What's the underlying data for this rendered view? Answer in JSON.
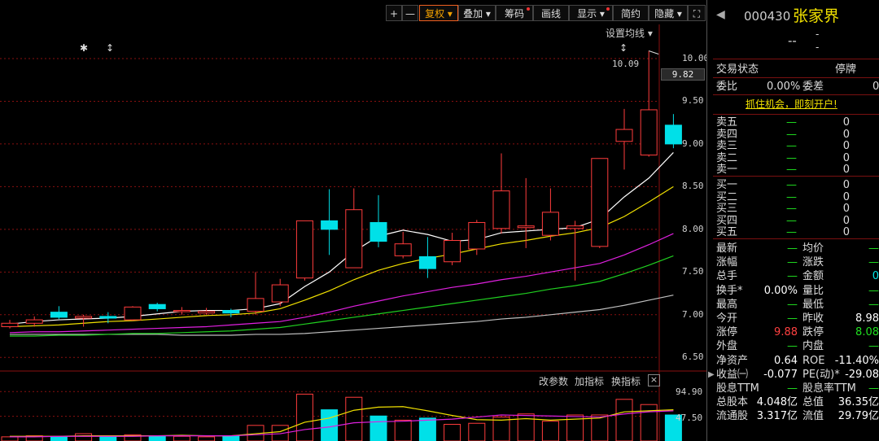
{
  "toolbar": {
    "plus": "+",
    "minus": "—",
    "restore_rights": "复权",
    "overlay": "叠加",
    "chips": "筹码",
    "draw_line": "画线",
    "display": "显示",
    "simple": "简约",
    "hide": "隐藏",
    "ma_settings": "设置均线"
  },
  "chart": {
    "high_label": "10.09",
    "current_price_tag": "9.82",
    "yaxis_ticks": [
      "10.00",
      "9.50",
      "9.00",
      "8.50",
      "8.00",
      "7.50",
      "7.00",
      "6.50"
    ],
    "indicator_buttons": {
      "change_params": "改参数",
      "add_indicator": "加指标",
      "switch_indicator": "换指标",
      "close": "×"
    },
    "volume_ticks": [
      "94.90",
      "47.50"
    ],
    "colors": {
      "up": "#ff3c3c",
      "down": "#00e0e8",
      "ma5": "#ffffff",
      "ma10": "#f0e000",
      "ma20": "#e020e0",
      "ma30": "#20d020",
      "ma60": "#c0c0c0",
      "grid": "#8a1010"
    }
  },
  "chart_data": {
    "type": "candlestick",
    "ylim": [
      6.35,
      10.4
    ],
    "candles": [
      {
        "o": 6.86,
        "c": 6.9,
        "h": 6.94,
        "l": 6.84
      },
      {
        "o": 6.9,
        "c": 6.94,
        "h": 6.98,
        "l": 6.86
      },
      {
        "o": 7.03,
        "c": 6.97,
        "h": 7.1,
        "l": 6.95
      },
      {
        "o": 6.96,
        "c": 6.98,
        "h": 7.0,
        "l": 6.86
      },
      {
        "o": 6.98,
        "c": 6.96,
        "h": 7.03,
        "l": 6.9
      },
      {
        "o": 6.94,
        "c": 7.09,
        "h": 7.1,
        "l": 6.93
      },
      {
        "o": 7.12,
        "c": 7.07,
        "h": 7.14,
        "l": 7.04
      },
      {
        "o": 7.05,
        "c": 7.05,
        "h": 7.09,
        "l": 7.0
      },
      {
        "o": 7.02,
        "c": 7.04,
        "h": 7.08,
        "l": 7.0
      },
      {
        "o": 7.05,
        "c": 7.02,
        "h": 7.07,
        "l": 6.97
      },
      {
        "o": 7.04,
        "c": 7.19,
        "h": 7.5,
        "l": 7.0
      },
      {
        "o": 7.15,
        "c": 7.35,
        "h": 7.42,
        "l": 7.1
      },
      {
        "o": 7.43,
        "c": 8.1,
        "h": 8.1,
        "l": 7.4
      },
      {
        "o": 8.1,
        "c": 8.0,
        "h": 8.47,
        "l": 7.7
      },
      {
        "o": 7.55,
        "c": 8.23,
        "h": 8.48,
        "l": 7.55
      },
      {
        "o": 8.08,
        "c": 7.86,
        "h": 8.4,
        "l": 7.79
      },
      {
        "o": 7.69,
        "c": 7.83,
        "h": 7.97,
        "l": 7.66
      },
      {
        "o": 7.68,
        "c": 7.54,
        "h": 7.91,
        "l": 7.43
      },
      {
        "o": 7.62,
        "c": 7.87,
        "h": 7.96,
        "l": 7.58
      },
      {
        "o": 7.77,
        "c": 8.08,
        "h": 8.11,
        "l": 7.7
      },
      {
        "o": 8.01,
        "c": 8.45,
        "h": 8.89,
        "l": 7.95
      },
      {
        "o": 8.02,
        "c": 8.04,
        "h": 8.6,
        "l": 7.78
      },
      {
        "o": 7.93,
        "c": 8.2,
        "h": 8.48,
        "l": 7.87
      },
      {
        "o": 8.01,
        "c": 8.04,
        "h": 8.1,
        "l": 7.4
      },
      {
        "o": 7.8,
        "c": 8.83,
        "h": 8.83,
        "l": 7.78
      },
      {
        "o": 9.03,
        "c": 9.17,
        "h": 9.41,
        "l": 8.7
      },
      {
        "o": 8.87,
        "c": 9.4,
        "h": 10.09,
        "l": 8.85
      },
      {
        "o": 9.22,
        "c": 9.0,
        "h": 9.35,
        "l": 8.95
      }
    ],
    "ma5": [
      6.89,
      6.92,
      6.94,
      6.95,
      6.96,
      6.98,
      7.01,
      7.04,
      7.05,
      7.05,
      7.07,
      7.13,
      7.33,
      7.5,
      7.74,
      7.92,
      7.99,
      7.94,
      7.86,
      7.88,
      7.96,
      7.98,
      8.0,
      8.02,
      8.12,
      8.38,
      8.6,
      8.9
    ],
    "ma10": [
      6.86,
      6.87,
      6.88,
      6.9,
      6.92,
      6.93,
      6.95,
      6.97,
      6.99,
      7.0,
      7.02,
      7.07,
      7.17,
      7.28,
      7.41,
      7.52,
      7.6,
      7.66,
      7.71,
      7.77,
      7.83,
      7.87,
      7.92,
      7.96,
      8.02,
      8.15,
      8.32,
      8.5
    ],
    "ma20": [
      6.79,
      6.8,
      6.8,
      6.81,
      6.82,
      6.83,
      6.84,
      6.85,
      6.86,
      6.88,
      6.9,
      6.92,
      6.97,
      7.03,
      7.1,
      7.16,
      7.22,
      7.27,
      7.32,
      7.36,
      7.41,
      7.45,
      7.5,
      7.55,
      7.6,
      7.7,
      7.82,
      7.95
    ],
    "ma30": [
      6.75,
      6.75,
      6.76,
      6.76,
      6.77,
      6.78,
      6.78,
      6.79,
      6.8,
      6.81,
      6.83,
      6.85,
      6.89,
      6.93,
      6.97,
      7.01,
      7.05,
      7.09,
      7.13,
      7.17,
      7.21,
      7.25,
      7.3,
      7.34,
      7.39,
      7.48,
      7.58,
      7.69
    ],
    "ma60": [
      6.77,
      6.77,
      6.77,
      6.77,
      6.77,
      6.77,
      6.77,
      6.76,
      6.76,
      6.76,
      6.77,
      6.77,
      6.78,
      6.8,
      6.82,
      6.84,
      6.86,
      6.88,
      6.9,
      6.92,
      6.95,
      6.97,
      7.0,
      7.03,
      7.06,
      7.11,
      7.17,
      7.23
    ],
    "volume_ylim": [
      0,
      100
    ],
    "volume": [
      8,
      10,
      8,
      14,
      9,
      12,
      10,
      9,
      8,
      10,
      30,
      30,
      90,
      60,
      84,
      48,
      40,
      44,
      32,
      34,
      46,
      52,
      38,
      50,
      50,
      80,
      70,
      50
    ],
    "vol_ma5": [
      9,
      9,
      9,
      10,
      10,
      10,
      10,
      11,
      10,
      10,
      14,
      18,
      36,
      44,
      59,
      65,
      66,
      58,
      49,
      41,
      40,
      43,
      40,
      42,
      44,
      56,
      58,
      60
    ],
    "vol_ma10": [
      8,
      8,
      9,
      9,
      9,
      9,
      10,
      10,
      10,
      10,
      12,
      14,
      22,
      27,
      35,
      37,
      38,
      40,
      42,
      46,
      50,
      49,
      48,
      47,
      46,
      52,
      56,
      58
    ]
  },
  "quote": {
    "code": "000430",
    "name": "张家界",
    "price": "--",
    "change_top": "-",
    "change_bottom": "-",
    "status_label": "交易状态",
    "status_value": "停牌",
    "weibi_label": "委比",
    "weibi_value": "0.00%",
    "weicha_label": "委差",
    "weicha_value": "0",
    "promo": "抓住机会，即刻开户!",
    "sell_levels": [
      {
        "label": "卖五",
        "price": "—",
        "vol": "0"
      },
      {
        "label": "卖四",
        "price": "—",
        "vol": "0"
      },
      {
        "label": "卖三",
        "price": "—",
        "vol": "0"
      },
      {
        "label": "卖二",
        "price": "—",
        "vol": "0"
      },
      {
        "label": "卖一",
        "price": "—",
        "vol": "0"
      }
    ],
    "buy_levels": [
      {
        "label": "买一",
        "price": "—",
        "vol": "0"
      },
      {
        "label": "买二",
        "price": "—",
        "vol": "0"
      },
      {
        "label": "买三",
        "price": "—",
        "vol": "0"
      },
      {
        "label": "买四",
        "price": "—",
        "vol": "0"
      },
      {
        "label": "买五",
        "price": "—",
        "vol": "0"
      }
    ],
    "stats": [
      {
        "l1": "最新",
        "v1": "—",
        "l2": "均价",
        "v2": "—"
      },
      {
        "l1": "涨幅",
        "v1": "—",
        "l2": "涨跌",
        "v2": "—"
      },
      {
        "l1": "总手",
        "v1": "—",
        "l2": "金额",
        "v2": "0"
      },
      {
        "l1": "换手*",
        "v1": "0.00%",
        "l2": "量比",
        "v2": "—"
      },
      {
        "l1": "最高",
        "v1": "—",
        "l2": "最低",
        "v2": "—"
      },
      {
        "l1": "今开",
        "v1": "—",
        "l2": "昨收",
        "v2": "8.98"
      },
      {
        "l1": "涨停",
        "v1": "9.88",
        "l2": "跌停",
        "v2": "8.08"
      },
      {
        "l1": "外盘",
        "v1": "—",
        "l2": "内盘",
        "v2": "—"
      },
      {
        "l1": "净资产",
        "v1": "0.64",
        "l2": "ROE",
        "v2": "-11.40%"
      },
      {
        "l1": "收益㈠",
        "v1": "-0.077",
        "l2": "PE(动)*",
        "v2": "-29.08"
      },
      {
        "l1": "股息TTM",
        "v1": "—",
        "l2": "股息率TTM",
        "v2": "—"
      },
      {
        "l1": "总股本",
        "v1": "4.048亿",
        "l2": "总值",
        "v2": "36.35亿"
      },
      {
        "l1": "流通股",
        "v1": "3.317亿",
        "l2": "流值",
        "v2": "29.79亿"
      }
    ]
  }
}
